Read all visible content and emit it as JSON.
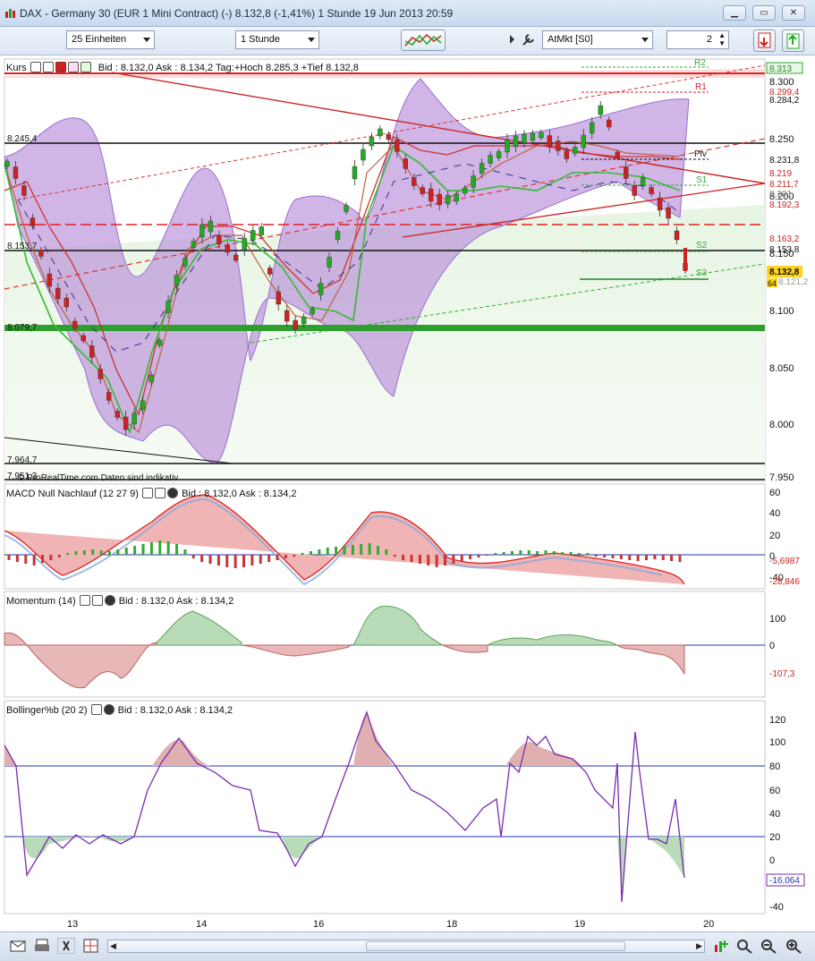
{
  "window": {
    "title": "DAX - Germany 30 (EUR 1 Mini Contract) (-)   8.132,8 (-1,41%)   1 Stunde  19 Jun 2013 20:59"
  },
  "toolbar": {
    "units": "25 Einheiten",
    "interval": "1 Stunde",
    "order_type": "AtMkt [S0]",
    "quantity": "2"
  },
  "colors": {
    "bull": "#22aa22",
    "bear": "#cc2222",
    "band": "#9a6fd0",
    "accent": "#3366cc"
  },
  "main_panel": {
    "header": "Kurs",
    "quote": "Bid : 8.132,0 Ask : 8.134,2 Tag:+Hoch 8.285,3 +Tief 8.132,8",
    "watermark": "© ProRealTime.com  Daten sind indikativ",
    "left_labels": [
      "8.245,4",
      "8.153,7",
      "8.079,7",
      "7.964,7",
      "7.951,3"
    ],
    "pivot_labels": [
      "R2",
      "R1",
      "Piv",
      "S1",
      "S2",
      "S3"
    ],
    "price_axis": [
      "8.300",
      "8.250",
      "8.200",
      "8.150",
      "8.100",
      "8.050",
      "8.000",
      "7.950"
    ],
    "price_tags": [
      "8.313",
      "8.299,4",
      "8.284,2",
      "8.231,8",
      "8.219",
      "8.211,7",
      "8.201",
      "8.192,3",
      "8.163,2",
      "8.153,8",
      "8.132,8",
      "8.121,2",
      "64"
    ]
  },
  "macd_panel": {
    "header": "MACD Null Nachlauf (12 27 9)",
    "quote": "Bid : 8.132,0 Ask : 8.134,2",
    "axis": [
      "60",
      "40",
      "20",
      "0",
      "-20",
      "-40"
    ],
    "tags": [
      "-5,6987",
      "-28,846"
    ]
  },
  "momentum_panel": {
    "header": "Momentum (14)",
    "quote": "Bid : 8.132,0 Ask : 8.134,2",
    "axis": [
      "100",
      "0"
    ],
    "tags": [
      "-107,3"
    ]
  },
  "bollinger_panel": {
    "header": "Bollinger%b (20 2)",
    "quote": "Bid : 8.132,0 Ask : 8.134,2",
    "axis": [
      "120",
      "100",
      "80",
      "60",
      "40",
      "20",
      "0",
      "-20",
      "-40"
    ],
    "tags": [
      "-16,064"
    ]
  },
  "time_axis": [
    "13",
    "14",
    "16",
    "18",
    "19",
    "20"
  ]
}
